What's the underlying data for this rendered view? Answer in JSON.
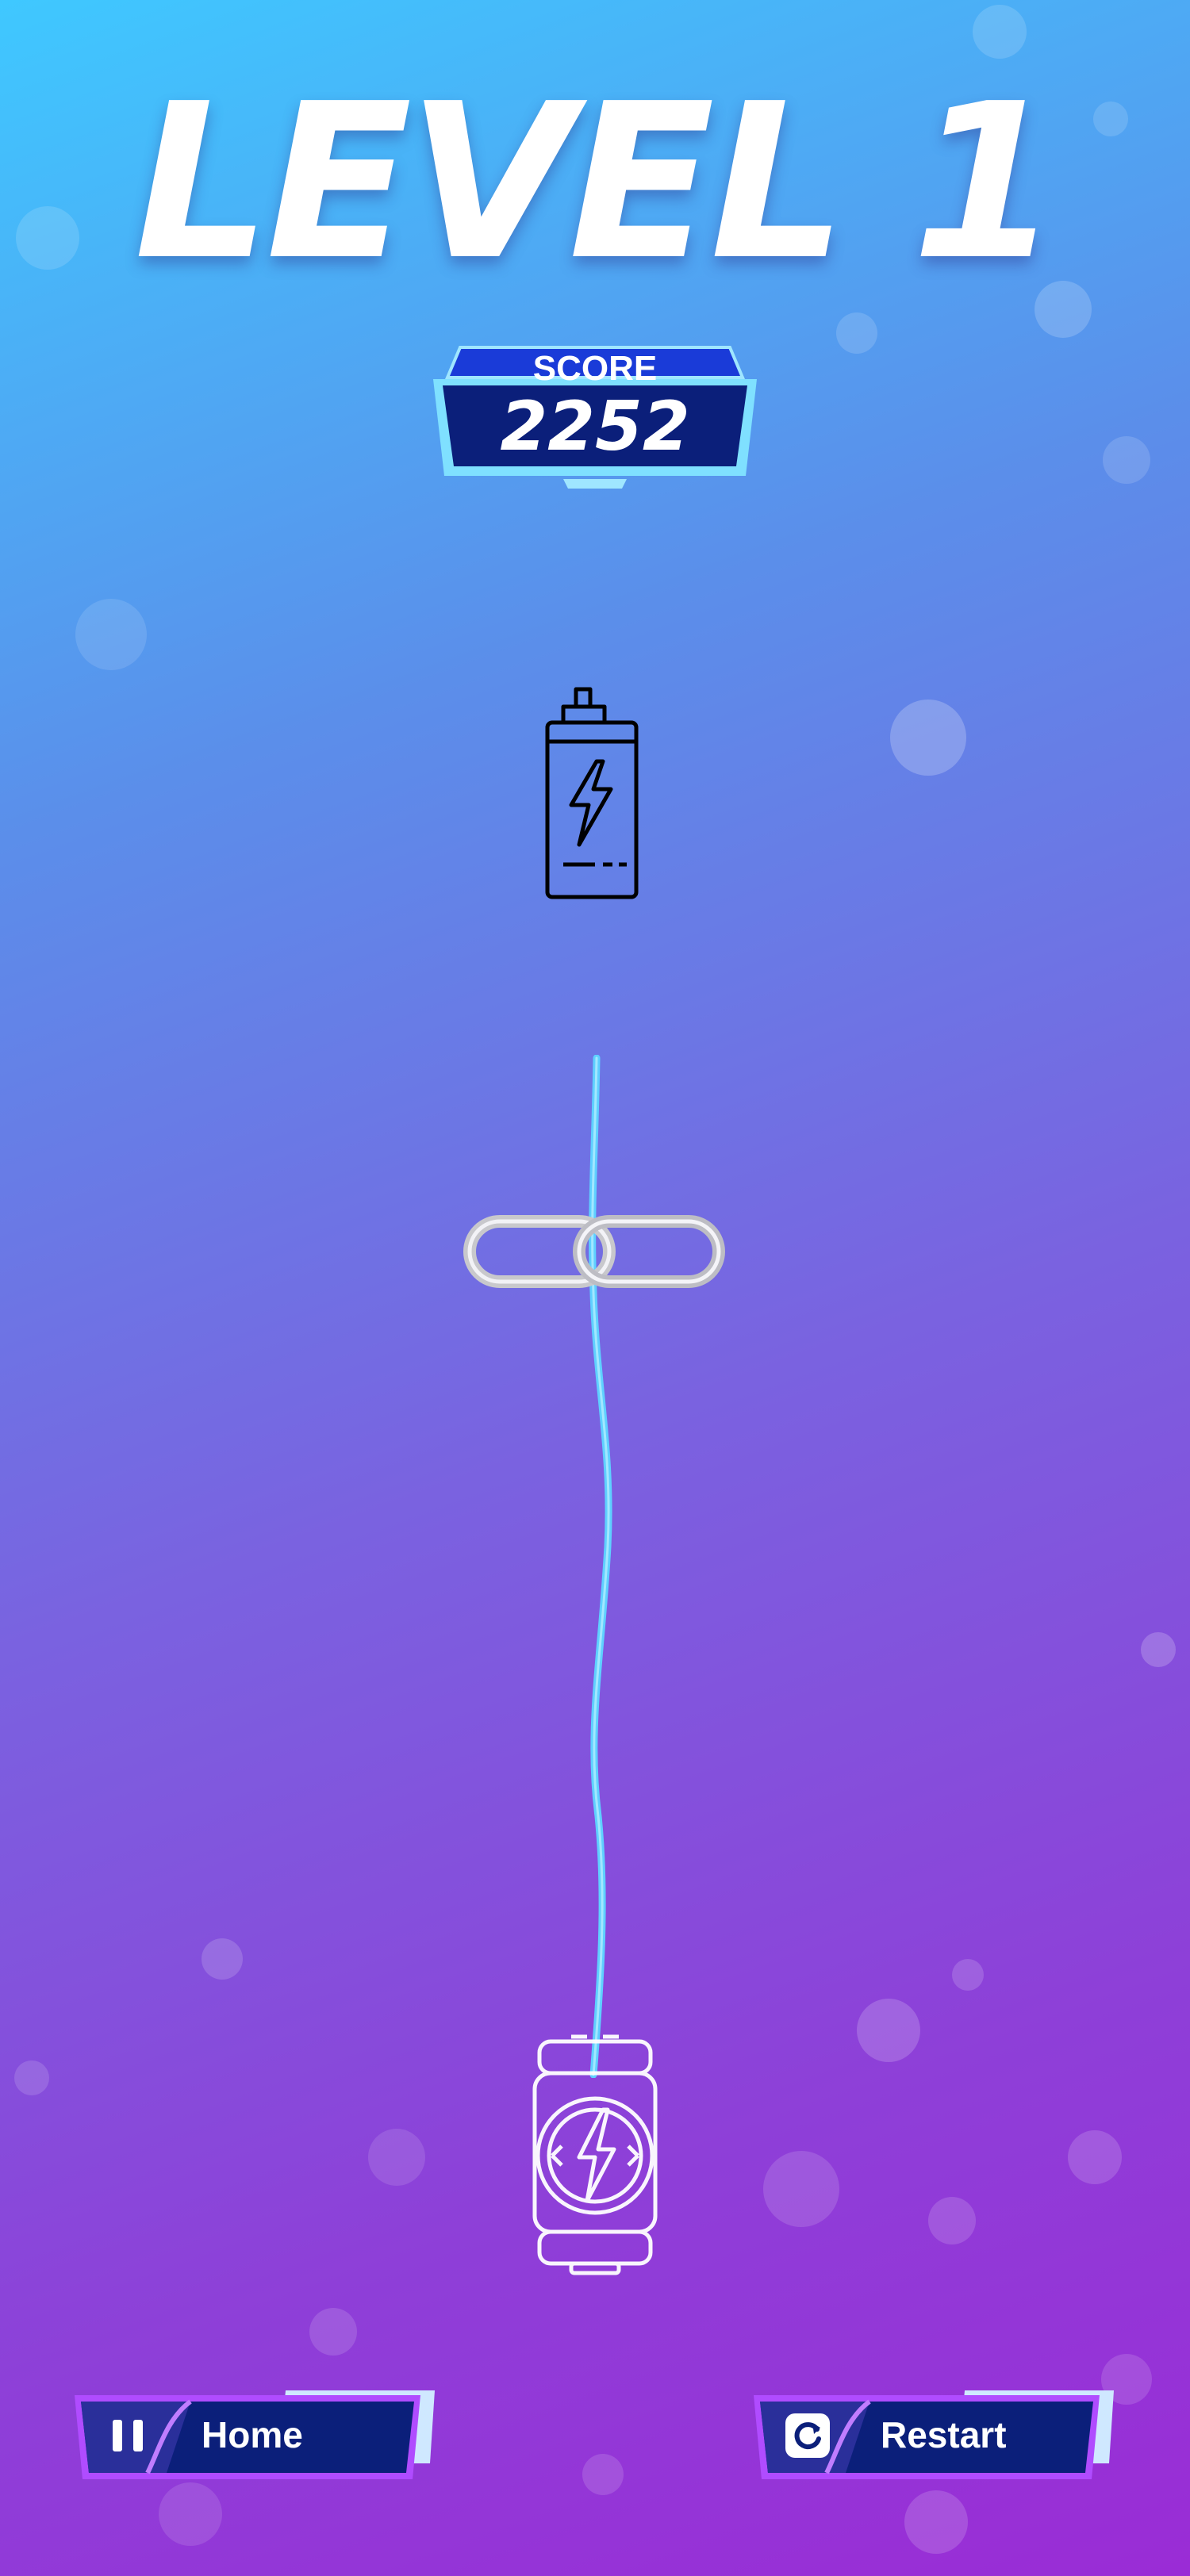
{
  "hud": {
    "level_title": "LEVEL 1",
    "score_label": "SCORE",
    "score_value": "2252"
  },
  "game": {
    "target": "battery-icon",
    "obstacle": "chain-link",
    "launcher": "lightning-capsule",
    "rope_color": "#5fd0ff"
  },
  "controls": {
    "home": {
      "label": "Home",
      "icon": "pause-icon"
    },
    "restart": {
      "label": "Restart",
      "icon": "restart-icon"
    }
  },
  "colors": {
    "bg_top": "#3fc8ff",
    "bg_bottom": "#9a2cd6",
    "panel_dark": "#0b1f7a",
    "accent_purple": "#b04cff"
  }
}
